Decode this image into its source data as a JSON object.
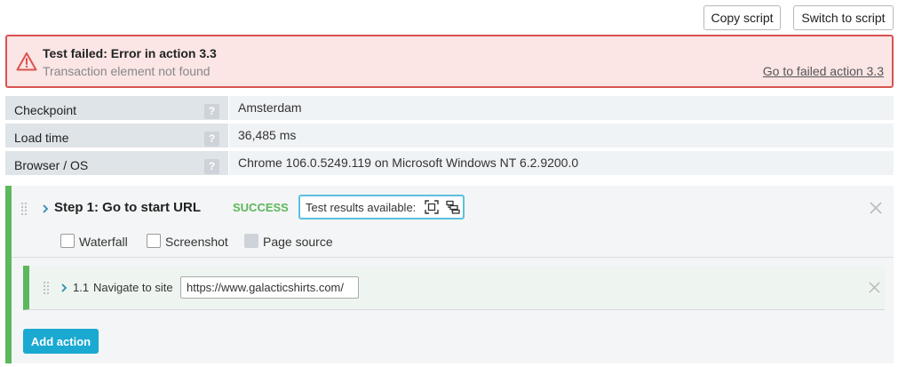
{
  "toolbar": {
    "copy_label": "Copy script",
    "switch_label": "Switch to script"
  },
  "alert": {
    "title": "Test failed: Error in action 3.3",
    "subtitle": "Transaction element not found",
    "link": "Go to failed action 3.3"
  },
  "info": [
    {
      "label": "Checkpoint",
      "value": "Amsterdam",
      "help": "?"
    },
    {
      "label": "Load time",
      "value": "36,485 ms",
      "help": "?"
    },
    {
      "label": "Browser / OS",
      "value": "Chrome 106.0.5249.119 on Microsoft Windows NT 6.2.9200.0",
      "help": "?"
    }
  ],
  "step": {
    "title": "Step 1: Go to start URL",
    "status": "SUCCESS",
    "results_label": "Test results available:",
    "checkboxes": [
      {
        "label": "Waterfall",
        "checked": false
      },
      {
        "label": "Screenshot",
        "checked": false
      },
      {
        "label": "Page source",
        "checked": false,
        "disabled": true
      }
    ]
  },
  "action": {
    "number": "1.1",
    "label": "Navigate to site",
    "url": "https://www.galacticshirts.com/"
  },
  "add_action_label": "Add action",
  "colors": {
    "alert_border": "#d9534f",
    "alert_bg": "#fbe5e5",
    "success": "#5cb85c",
    "accent": "#1aa9d1",
    "results_border": "#5bc0de"
  },
  "icons": {
    "alert": "warning-triangle-icon",
    "screenshot": "screenshot-frame-icon",
    "source": "page-tree-icon",
    "close": "close-icon",
    "expand": "chevron-right-icon",
    "drag": "drag-handle-icon"
  }
}
